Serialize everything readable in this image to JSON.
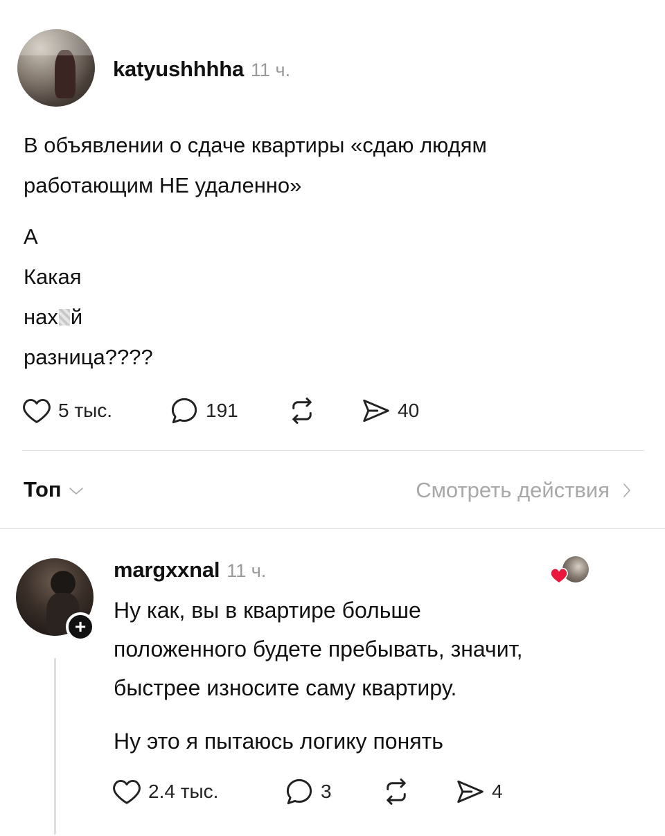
{
  "post": {
    "username": "katyushhhha",
    "time": "11 ч.",
    "paragraph1": [
      "В объявлении о сдаче квартиры «сдаю людям",
      "работающим НЕ удаленно»"
    ],
    "lines": [
      "А",
      "Какая",
      "нах",
      "й",
      "разница????"
    ],
    "stats": {
      "likes": "5 тыс.",
      "comments": "191",
      "shares": "40"
    }
  },
  "sort": {
    "label": "Топ",
    "activity_link": "Смотреть действия"
  },
  "reply": {
    "username": "margxxnal",
    "time": "11 ч.",
    "paragraph1": [
      "Ну как, вы в квартире больше",
      "положенного будете пребывать, значит,",
      "быстрее износите саму квартиру."
    ],
    "paragraph2": "Ну это я пытаюсь логику понять",
    "stats": {
      "likes": "2.4 тыс.",
      "comments": "3",
      "shares": "4"
    }
  },
  "icons": {
    "like": "heart-outline-icon",
    "comment": "speech-bubble-icon",
    "repost": "repost-arrows-icon",
    "share": "send-arrow-icon",
    "liked_by_author": "heart-with-avatar-icon",
    "follow": "plus-icon"
  },
  "colors": {
    "text": "#111111",
    "muted": "#9a9a9a",
    "liked_heart": "#e8173b",
    "divider": "#e3e3e3"
  }
}
